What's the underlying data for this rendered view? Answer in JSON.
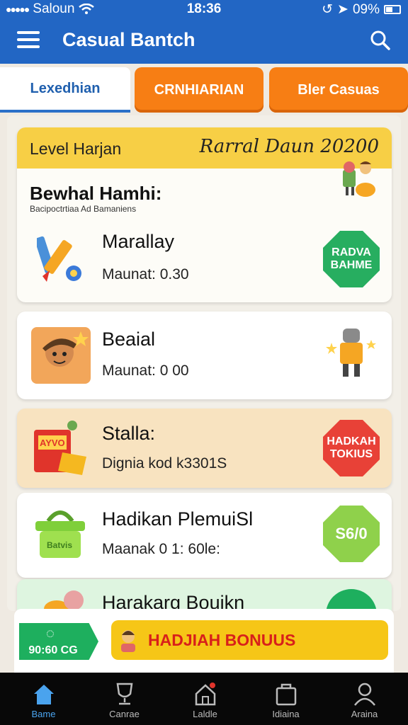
{
  "status_bar": {
    "carrier": "Saloun",
    "time": "18:36",
    "battery": "09%"
  },
  "header": {
    "title": "Casual Bantch",
    "menu_icon": "hamburger-icon",
    "search_icon": "search-icon"
  },
  "tabs": [
    {
      "label": "Lexedhian",
      "active": true
    },
    {
      "label": "CRNHIARIAN",
      "active": false
    },
    {
      "label": "Bler Casuas",
      "active": false
    }
  ],
  "feature_card": {
    "header_left": "Level Harjan",
    "header_right": "Rarral Daun 20200",
    "subtitle": "Bewhal Hamhi:",
    "caption": "Bacipoctrtiaa Ad Bamaniens"
  },
  "items": [
    {
      "title": "Marallay",
      "subtitle": "Maunat: 0.30",
      "badge": "RADVA BAHME",
      "badge_color": "#27ae60",
      "icon": "pencil-icon"
    },
    {
      "title": "Beaial",
      "subtitle": "Maunat: 0 00",
      "badge": "",
      "icon": "character-icon"
    },
    {
      "title": "Stalla:",
      "subtitle": "Dignia kod k3301S",
      "badge": "HADKAH TOKIUS",
      "badge_color": "#e84137",
      "icon": "gift-box-icon"
    },
    {
      "title": "Hadikan PlemuiSl",
      "subtitle": "Maanak 0 1: 60le:",
      "badge": "S6/0",
      "badge_color": "#8fd14b",
      "icon": "basket-icon"
    },
    {
      "title": "Harakarg Bouikn",
      "subtitle": "",
      "badge": "",
      "icon": "coin-icon"
    }
  ],
  "promo": {
    "left_label": "90:60 CG",
    "button_label": "HADJIAH BONUUS"
  },
  "bottom_nav": [
    {
      "label": "Bame",
      "icon": "home-icon",
      "active": true
    },
    {
      "label": "Canrae",
      "icon": "trophy-icon",
      "active": false
    },
    {
      "label": "Laldle",
      "icon": "house-alert-icon",
      "active": false
    },
    {
      "label": "Idiaina",
      "icon": "bag-icon",
      "active": false
    },
    {
      "label": "Araina",
      "icon": "profile-icon",
      "active": false
    }
  ],
  "colors": {
    "primary": "#2266c4",
    "accent_orange": "#f77e14",
    "accent_yellow": "#f7cf45"
  }
}
